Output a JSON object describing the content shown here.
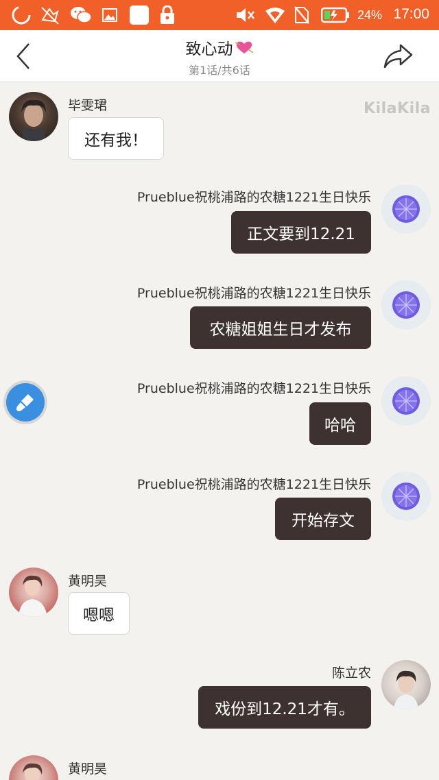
{
  "status_bar": {
    "time": "17:00",
    "battery_percent": "24%",
    "icons": [
      "loading-circle-icon",
      "muted-bird-icon",
      "wechat-icon",
      "image-icon",
      "blank-square-icon",
      "lock-icon",
      "mute-icon",
      "wifi-icon",
      "no-sim-icon",
      "battery-icon"
    ]
  },
  "header": {
    "title": "致心动",
    "subtitle": "第1话/共6话",
    "back_icon": "chevron-left-icon",
    "share_icon": "share-arrow-icon"
  },
  "watermark": "KilaKila",
  "messages": [
    {
      "side": "left",
      "name": "毕雯珺",
      "text": "还有我！"
    },
    {
      "side": "right",
      "name": "Prueblue祝桃浦路的农糖1221生日快乐",
      "text": "正文要到12.21"
    },
    {
      "side": "right",
      "name": "Prueblue祝桃浦路的农糖1221生日快乐",
      "text": "农糖姐姐生日才发布"
    },
    {
      "side": "right",
      "name": "Prueblue祝桃浦路的农糖1221生日快乐",
      "text": "哈哈"
    },
    {
      "side": "right",
      "name": "Prueblue祝桃浦路的农糖1221生日快乐",
      "text": "开始存文"
    },
    {
      "side": "left",
      "name": "黄明昊",
      "text": "嗯嗯"
    },
    {
      "side": "right",
      "name": "陈立农",
      "text": "戏份到12.21才有。"
    },
    {
      "side": "left",
      "name": "黄明昊",
      "text": ""
    }
  ],
  "floating_button_icon": "brush-icon",
  "colors": {
    "status_bar": "#f2602a",
    "right_bubble": "#3e3230",
    "background": "#f4f2ee",
    "orange_avatar": "#6e5be0"
  }
}
